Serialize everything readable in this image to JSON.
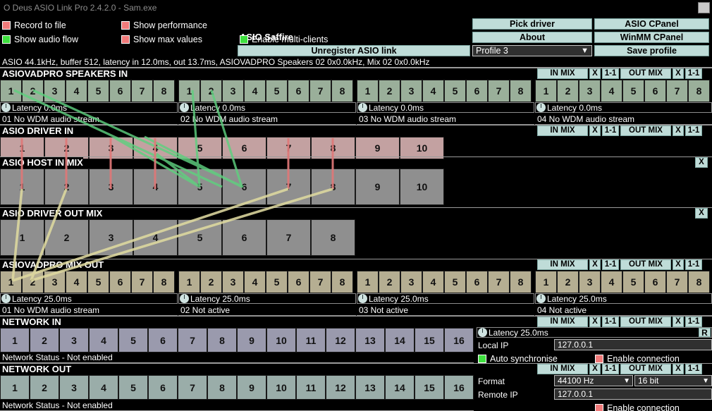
{
  "window": {
    "title": "O Deus ASIO Link Pro 2.4.2.0 - Sam.exe",
    "close_icon": "close-icon"
  },
  "header": {
    "checkboxes": [
      {
        "label": "Record to file",
        "state": "off",
        "color": "#f07a7a"
      },
      {
        "label": "Show audio flow",
        "state": "on",
        "color": "#3ee03e"
      },
      {
        "label": "Show performance",
        "state": "off",
        "color": "#f07a7a"
      },
      {
        "label": "Show max values",
        "state": "off",
        "color": "#f07a7a"
      }
    ],
    "asio_title": "ASIO Saffire",
    "multiclient": {
      "label": "Enable multi-clients",
      "state": "on",
      "color": "#3ee03e"
    },
    "unregister_button": "Unregister ASIO link",
    "profile_value": "Profile 3",
    "buttons": {
      "pick_driver": "Pick driver",
      "asio_cpanel": "ASIO CPanel",
      "about": "About",
      "winmm_cpanel": "WinMM CPanel",
      "save_profile": "Save profile"
    }
  },
  "status_bar": "ASIO 44.1kHz, buffer 512, latency in 12.0ms, out 13.7ms, ASIOVADPRO Speakers 02 0x0.0kHz, Mix 02 0x0.0kHz",
  "mix_buttons": {
    "in_mix": "IN MIX",
    "out_mix": "OUT MIX",
    "x": "X",
    "one_to_one": "1-1"
  },
  "sections": [
    {
      "title": "ASIOVADPRO SPEAKERS IN",
      "channel_color": "#9aaf9a",
      "devices": [
        {
          "latency": "Latency 0.0ms",
          "name": "01 No WDM audio stream",
          "channels": [
            "1",
            "2",
            "3",
            "4",
            "5",
            "6",
            "7",
            "8"
          ]
        },
        {
          "latency": "Latency 0.0ms",
          "name": "02 No WDM audio stream",
          "channels": [
            "1",
            "2",
            "3",
            "4",
            "5",
            "6",
            "7",
            "8"
          ]
        },
        {
          "latency": "Latency 0.0ms",
          "name": "03 No WDM audio stream",
          "channels": [
            "1",
            "2",
            "3",
            "4",
            "5",
            "6",
            "7",
            "8"
          ]
        },
        {
          "latency": "Latency 0.0ms",
          "name": "04 No WDM audio stream",
          "channels": [
            "1",
            "2",
            "3",
            "4",
            "5",
            "6",
            "7",
            "8"
          ]
        }
      ]
    },
    {
      "title": "ASIO DRIVER IN",
      "channel_color": "#c3a1a1",
      "channels": [
        "1",
        "2",
        "3",
        "4",
        "5",
        "6",
        "7",
        "8",
        "9",
        "10"
      ]
    },
    {
      "title": "ASIO HOST IN MIX",
      "channel_color": "#8f8f8f",
      "channels": [
        "1",
        "2",
        "3",
        "4",
        "5",
        "6",
        "7",
        "8",
        "9",
        "10"
      ]
    },
    {
      "title": "ASIO DRIVER OUT MIX",
      "channel_color": "#8f8f8f",
      "channels": [
        "1",
        "2",
        "3",
        "4",
        "5",
        "6",
        "7",
        "8"
      ]
    },
    {
      "title": "ASIOVADPRO MIX OUT",
      "channel_color": "#b5ae92",
      "devices": [
        {
          "latency": "Latency 25.0ms",
          "name": "01 No WDM audio stream",
          "channels": [
            "1",
            "2",
            "3",
            "4",
            "5",
            "6",
            "7",
            "8"
          ]
        },
        {
          "latency": "Latency 25.0ms",
          "name": "02 Not active",
          "channels": [
            "1",
            "2",
            "3",
            "4",
            "5",
            "6",
            "7",
            "8"
          ]
        },
        {
          "latency": "Latency 25.0ms",
          "name": "03 Not active",
          "channels": [
            "1",
            "2",
            "3",
            "4",
            "5",
            "6",
            "7",
            "8"
          ]
        },
        {
          "latency": "Latency 25.0ms",
          "name": "04 Not active",
          "channels": [
            "1",
            "2",
            "3",
            "4",
            "5",
            "6",
            "7",
            "8"
          ]
        }
      ]
    },
    {
      "title": "NETWORK IN",
      "channel_color": "#9a9aad",
      "channels": [
        "1",
        "2",
        "3",
        "4",
        "5",
        "6",
        "7",
        "8",
        "9",
        "10",
        "11",
        "12",
        "13",
        "14",
        "15",
        "16"
      ],
      "status": "Network Status - Not enabled"
    },
    {
      "title": "NETWORK OUT",
      "channel_color": "#9aada9",
      "channels": [
        "1",
        "2",
        "3",
        "4",
        "5",
        "6",
        "7",
        "8",
        "9",
        "10",
        "11",
        "12",
        "13",
        "14",
        "15",
        "16"
      ],
      "status": "Network Status - Not enabled"
    }
  ],
  "network_in_panel": {
    "latency": "Latency 25.0ms",
    "reset_button": "R",
    "local_ip_label": "Local IP",
    "local_ip_value": "127.0.0.1",
    "auto_sync": {
      "label": "Auto synchronise",
      "state": "on",
      "color": "#3ee03e"
    },
    "enable_conn": {
      "label": "Enable connection",
      "state": "off",
      "color": "#f07a7a"
    }
  },
  "network_out_panel": {
    "format_label": "Format",
    "format_rate": "44100 Hz",
    "format_bits": "16 bit",
    "remote_ip_label": "Remote IP",
    "remote_ip_value": "127.0.0.1",
    "enable_conn": {
      "label": "Enable connection",
      "state": "off",
      "color": "#f07a7a"
    }
  },
  "flow": {
    "green_color": "#5fd07f",
    "yellow_color": "#ded9a0",
    "red_color": "#e07878"
  }
}
